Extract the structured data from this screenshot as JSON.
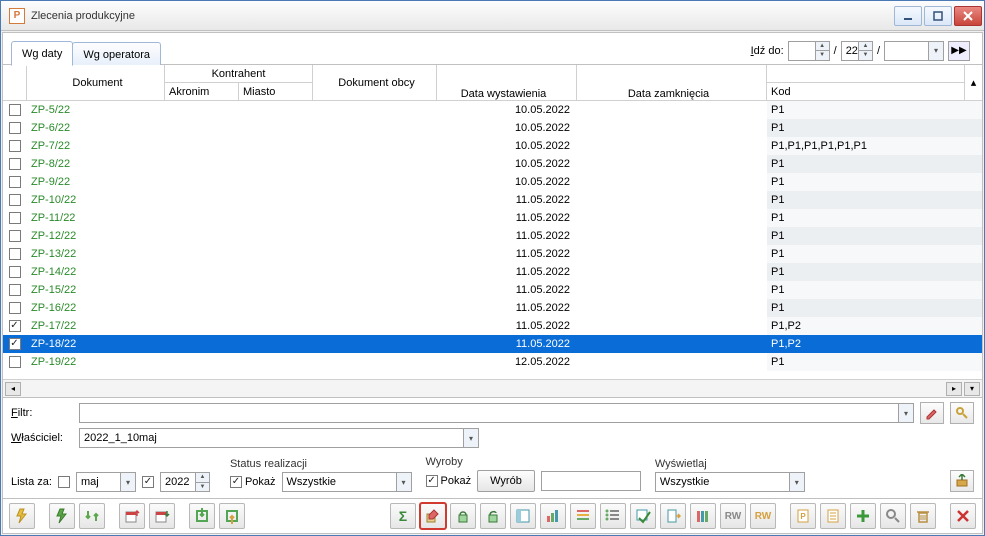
{
  "window": {
    "title": "Zlecenia produkcyjne"
  },
  "tabs": {
    "by_date": "Wg daty",
    "by_operator": "Wg operatora"
  },
  "goto": {
    "label": "Idź do:",
    "day": "",
    "num": "22",
    "combo": ""
  },
  "columns": {
    "dokument": "Dokument",
    "kontrahent": "Kontrahent",
    "akronim": "Akronim",
    "miasto": "Miasto",
    "obcy": "Dokument obcy",
    "data_wyst": "Data wystawienia",
    "data_zamk": "Data zamknięcia",
    "kod": "Kod"
  },
  "rows": [
    {
      "checked": false,
      "dokument": "ZP-5/22",
      "akr": "",
      "miasto": "",
      "obcy": "",
      "data": "10.05.2022",
      "zamk": "",
      "kod": "P1"
    },
    {
      "checked": false,
      "dokument": "ZP-6/22",
      "akr": "",
      "miasto": "",
      "obcy": "",
      "data": "10.05.2022",
      "zamk": "",
      "kod": "P1"
    },
    {
      "checked": false,
      "dokument": "ZP-7/22",
      "akr": "",
      "miasto": "",
      "obcy": "",
      "data": "10.05.2022",
      "zamk": "",
      "kod": "P1,P1,P1,P1,P1,P1"
    },
    {
      "checked": false,
      "dokument": "ZP-8/22",
      "akr": "",
      "miasto": "",
      "obcy": "",
      "data": "10.05.2022",
      "zamk": "",
      "kod": "P1"
    },
    {
      "checked": false,
      "dokument": "ZP-9/22",
      "akr": "",
      "miasto": "",
      "obcy": "",
      "data": "10.05.2022",
      "zamk": "",
      "kod": "P1"
    },
    {
      "checked": false,
      "dokument": "ZP-10/22",
      "akr": "",
      "miasto": "",
      "obcy": "",
      "data": "11.05.2022",
      "zamk": "",
      "kod": "P1"
    },
    {
      "checked": false,
      "dokument": "ZP-11/22",
      "akr": "",
      "miasto": "",
      "obcy": "",
      "data": "11.05.2022",
      "zamk": "",
      "kod": "P1"
    },
    {
      "checked": false,
      "dokument": "ZP-12/22",
      "akr": "",
      "miasto": "",
      "obcy": "",
      "data": "11.05.2022",
      "zamk": "",
      "kod": "P1"
    },
    {
      "checked": false,
      "dokument": "ZP-13/22",
      "akr": "",
      "miasto": "",
      "obcy": "",
      "data": "11.05.2022",
      "zamk": "",
      "kod": "P1"
    },
    {
      "checked": false,
      "dokument": "ZP-14/22",
      "akr": "",
      "miasto": "",
      "obcy": "",
      "data": "11.05.2022",
      "zamk": "",
      "kod": "P1"
    },
    {
      "checked": false,
      "dokument": "ZP-15/22",
      "akr": "",
      "miasto": "",
      "obcy": "",
      "data": "11.05.2022",
      "zamk": "",
      "kod": "P1"
    },
    {
      "checked": false,
      "dokument": "ZP-16/22",
      "akr": "",
      "miasto": "",
      "obcy": "",
      "data": "11.05.2022",
      "zamk": "",
      "kod": "P1"
    },
    {
      "checked": true,
      "dokument": "ZP-17/22",
      "akr": "",
      "miasto": "",
      "obcy": "",
      "data": "11.05.2022",
      "zamk": "",
      "kod": "P1,P2"
    },
    {
      "checked": true,
      "dokument": "ZP-18/22",
      "akr": "",
      "miasto": "",
      "obcy": "",
      "data": "11.05.2022",
      "zamk": "",
      "kod": "P1,P2",
      "selected": true
    },
    {
      "checked": false,
      "dokument": "ZP-19/22",
      "akr": "",
      "miasto": "",
      "obcy": "",
      "data": "12.05.2022",
      "zamk": "",
      "kod": "P1"
    }
  ],
  "filter": {
    "label": "Filtr:",
    "value": ""
  },
  "owner": {
    "label": "Właściciel:",
    "value": "2022_1_10maj"
  },
  "listfor": {
    "label": "Lista za:",
    "month": "maj",
    "year": "2022"
  },
  "status": {
    "head": "Status realizacji",
    "show": "Pokaż",
    "value": "Wszystkie"
  },
  "products": {
    "head": "Wyroby",
    "show": "Pokaż",
    "button": "Wyrób",
    "value": ""
  },
  "display": {
    "head": "Wyświetlaj",
    "value": "Wszystkie"
  }
}
